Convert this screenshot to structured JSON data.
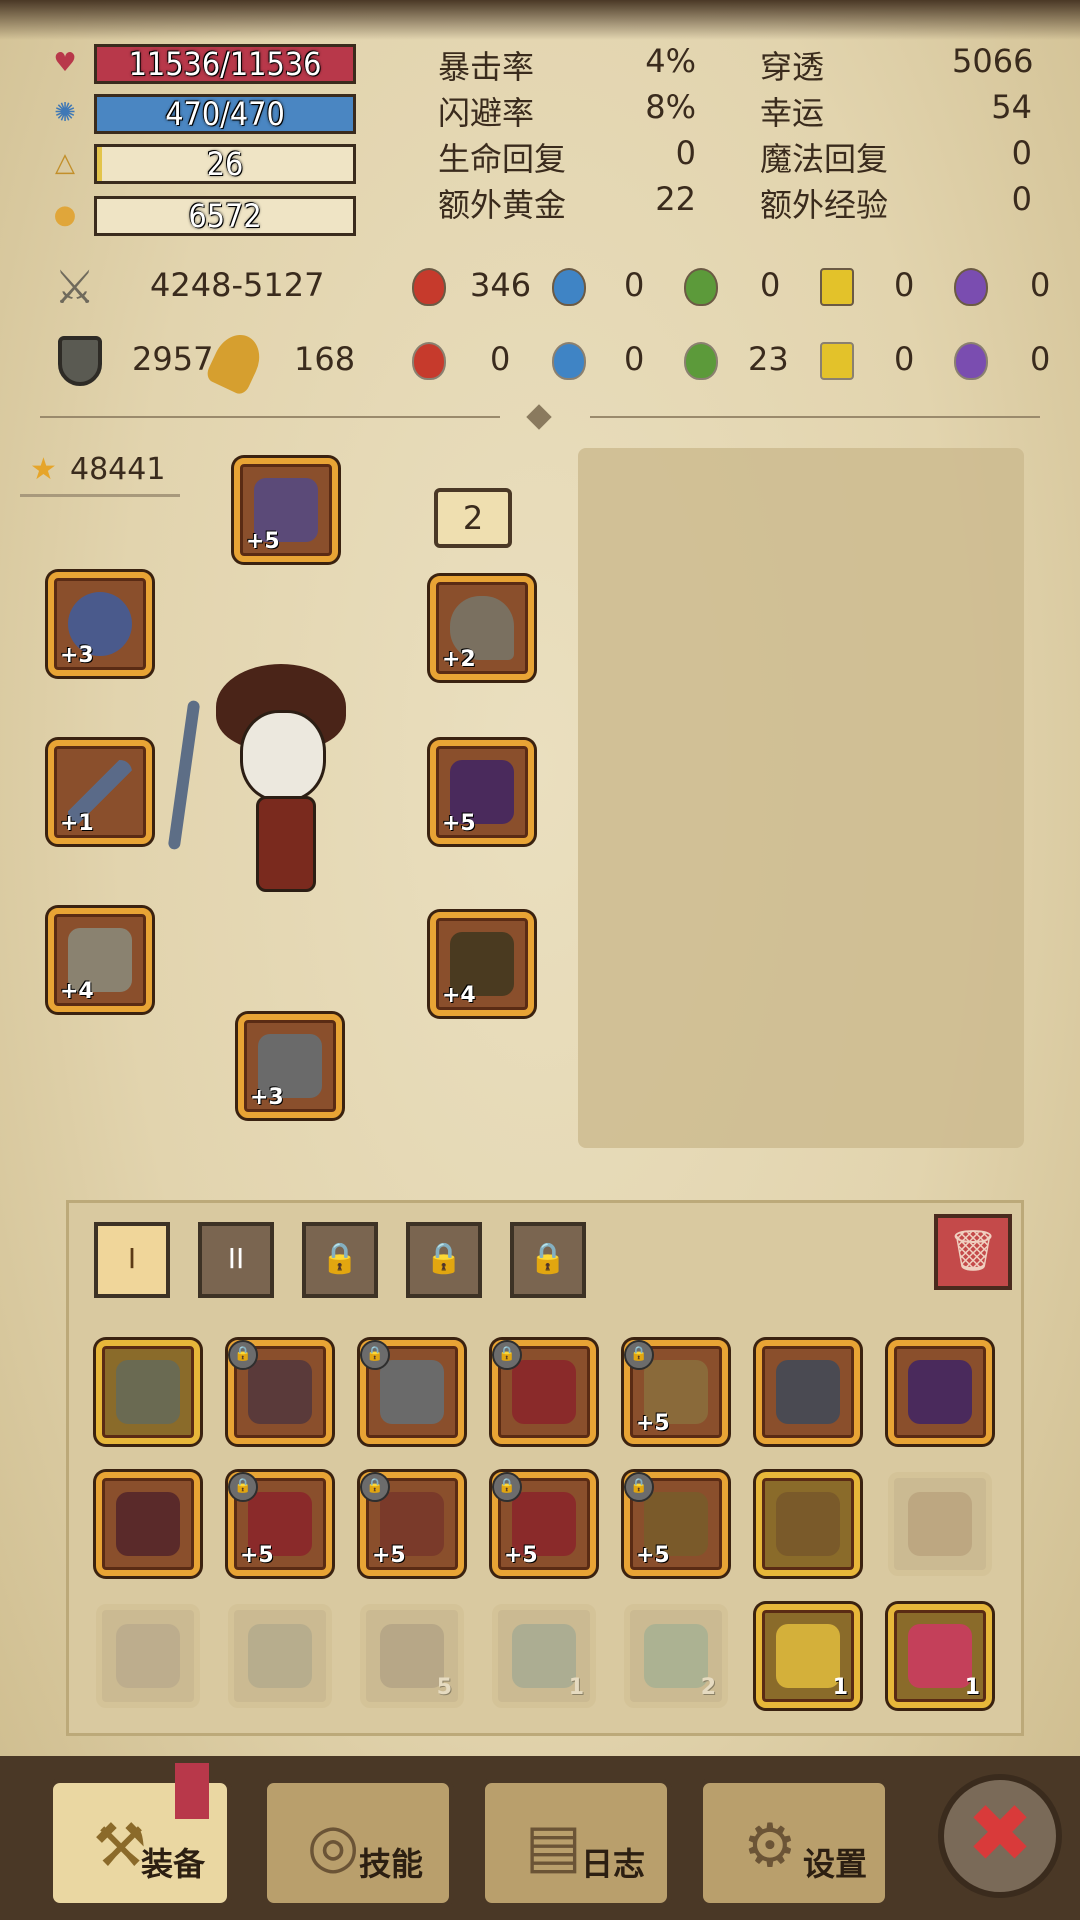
{
  "hp": {
    "value": "11536/11536",
    "fraction": 1.0,
    "color": "#b8384a"
  },
  "mp": {
    "value": "470/470",
    "fraction": 1.0,
    "color": "#4a86c2"
  },
  "level": {
    "value": "26",
    "fraction": 0.02,
    "color": "#e3c44a"
  },
  "gold": {
    "value": "6572"
  },
  "stats": [
    {
      "label": "暴击率",
      "value": "4%"
    },
    {
      "label": "穿透",
      "value": "5066"
    },
    {
      "label": "闪避率",
      "value": "8%"
    },
    {
      "label": "幸运",
      "value": "54"
    },
    {
      "label": "生命回复",
      "value": "0"
    },
    {
      "label": "魔法回复",
      "value": "0"
    },
    {
      "label": "额外黄金",
      "value": "22"
    },
    {
      "label": "额外经验",
      "value": "0"
    }
  ],
  "attack": {
    "range": "4248-5127",
    "fire": "346",
    "water": "0",
    "nature": "0",
    "light": "0",
    "shadow": "0"
  },
  "defense": {
    "armor": "2957",
    "magic": "168",
    "fire": "0",
    "water": "0",
    "nature": "23",
    "light": "0",
    "shadow": "0"
  },
  "score": "48441",
  "slot_badge": "2",
  "equipment": {
    "helmet": "+5",
    "ring": "+3",
    "necklace": "+2",
    "weapon": "+1",
    "gloves": "+5",
    "bracer": "+4",
    "pants": "+4",
    "boots": "+3"
  },
  "tabs": [
    "I",
    "II",
    "lock",
    "lock",
    "lock"
  ],
  "inventory": [
    {
      "plus": "",
      "locked": false,
      "faded": false,
      "gold": true
    },
    {
      "plus": "",
      "locked": true,
      "faded": false,
      "gold": false
    },
    {
      "plus": "",
      "locked": true,
      "faded": false,
      "gold": false
    },
    {
      "plus": "",
      "locked": true,
      "faded": false,
      "gold": false
    },
    {
      "plus": "+5",
      "locked": true,
      "faded": false,
      "gold": false
    },
    {
      "plus": "",
      "locked": false,
      "faded": false,
      "gold": false
    },
    {
      "plus": "",
      "locked": false,
      "faded": false,
      "gold": false
    },
    {
      "plus": "",
      "locked": false,
      "faded": false,
      "gold": false
    },
    {
      "plus": "+5",
      "locked": true,
      "faded": false,
      "gold": false
    },
    {
      "plus": "+5",
      "locked": true,
      "faded": false,
      "gold": false
    },
    {
      "plus": "+5",
      "locked": true,
      "faded": false,
      "gold": false
    },
    {
      "plus": "+5",
      "locked": true,
      "faded": false,
      "gold": false
    },
    {
      "plus": "",
      "locked": false,
      "faded": false,
      "gold": true
    },
    {
      "plus": "",
      "locked": false,
      "faded": true,
      "gold": false
    },
    {
      "plus": "",
      "locked": false,
      "faded": true,
      "gold": false
    },
    {
      "plus": "",
      "locked": false,
      "faded": true,
      "gold": false
    },
    {
      "plus": "5",
      "locked": false,
      "faded": true,
      "gold": false
    },
    {
      "plus": "1",
      "locked": false,
      "faded": true,
      "gold": false
    },
    {
      "plus": "2",
      "locked": false,
      "faded": true,
      "gold": false
    },
    {
      "plus": "1",
      "locked": false,
      "faded": false,
      "gold": true
    },
    {
      "plus": "1",
      "locked": false,
      "faded": false,
      "gold": true
    }
  ],
  "nav": {
    "equip": "装备",
    "skills": "技能",
    "log": "日志",
    "settings": "设置"
  },
  "icons": {
    "heart": "heart-icon",
    "mana": "mana-icon",
    "level": "level-icon",
    "gold": "gold-coins-icon",
    "sword": "crossed-swords-icon",
    "shield": "shield-icon",
    "star": "star-icon",
    "trash": "trash-icon",
    "close": "close-icon"
  }
}
